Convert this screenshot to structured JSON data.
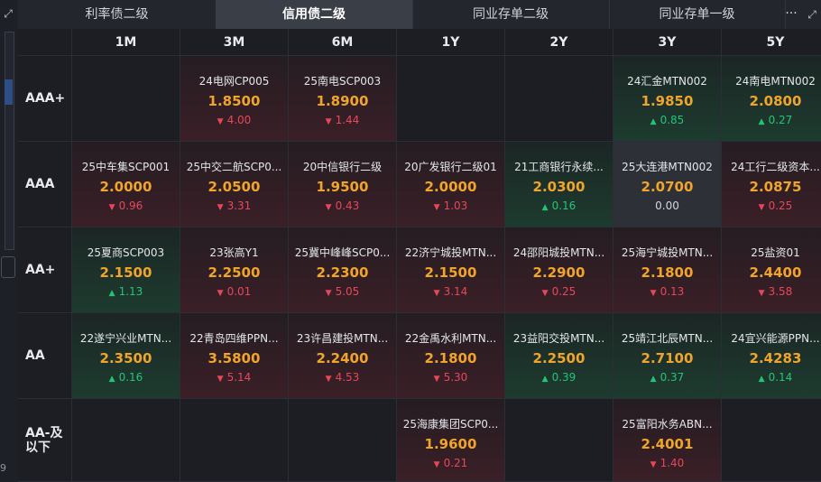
{
  "tabs": [
    {
      "label": "利率债二级",
      "active": false
    },
    {
      "label": "信用债二级",
      "active": true
    },
    {
      "label": "同业存单二级",
      "active": false
    },
    {
      "label": "同业存单一级",
      "active": false
    }
  ],
  "more_label": "···",
  "left_strip_number": "9",
  "columns": [
    "1M",
    "3M",
    "6M",
    "1Y",
    "2Y",
    "3Y",
    "5Y"
  ],
  "rows": [
    {
      "label": "AAA+",
      "cells": [
        null,
        {
          "name": "24电网CP005",
          "yield": "1.8500",
          "change": "4.00",
          "dir": "down",
          "tone": "red"
        },
        {
          "name": "25南电SCP003",
          "yield": "1.8900",
          "change": "1.44",
          "dir": "down",
          "tone": "red"
        },
        null,
        null,
        {
          "name": "24汇金MTN002",
          "yield": "1.9850",
          "change": "0.85",
          "dir": "up",
          "tone": "green"
        },
        {
          "name": "24南电MTN002",
          "yield": "2.0800",
          "change": "0.27",
          "dir": "up",
          "tone": "green"
        }
      ]
    },
    {
      "label": "AAA",
      "cells": [
        {
          "name": "25中车集SCP001",
          "yield": "2.0000",
          "change": "0.96",
          "dir": "down",
          "tone": "red"
        },
        {
          "name": "25中交二航SCP0...",
          "yield": "2.0500",
          "change": "3.31",
          "dir": "down",
          "tone": "red"
        },
        {
          "name": "20中信银行二级",
          "yield": "1.9500",
          "change": "0.43",
          "dir": "down",
          "tone": "red"
        },
        {
          "name": "20广发银行二级01",
          "yield": "2.0000",
          "change": "1.03",
          "dir": "down",
          "tone": "red"
        },
        {
          "name": "21工商银行永续...",
          "yield": "2.0300",
          "change": "0.16",
          "dir": "up",
          "tone": "green"
        },
        {
          "name": "25大连港MTN002",
          "yield": "2.0700",
          "change": "0.00",
          "dir": "flat",
          "tone": "gray"
        },
        {
          "name": "24工行二级资本...",
          "yield": "2.0875",
          "change": "0.25",
          "dir": "down",
          "tone": "red"
        }
      ]
    },
    {
      "label": "AA+",
      "cells": [
        {
          "name": "25夏商SCP003",
          "yield": "2.1500",
          "change": "1.13",
          "dir": "up",
          "tone": "green"
        },
        {
          "name": "23张高Y1",
          "yield": "2.2500",
          "change": "0.01",
          "dir": "down",
          "tone": "red"
        },
        {
          "name": "25冀中峰峰SCP0...",
          "yield": "2.2300",
          "change": "5.05",
          "dir": "down",
          "tone": "red"
        },
        {
          "name": "22济宁城投MTN...",
          "yield": "2.1500",
          "change": "3.14",
          "dir": "down",
          "tone": "red"
        },
        {
          "name": "24邵阳城投MTN...",
          "yield": "2.2900",
          "change": "0.25",
          "dir": "down",
          "tone": "red"
        },
        {
          "name": "25海宁城投MTN...",
          "yield": "2.1800",
          "change": "0.13",
          "dir": "down",
          "tone": "red"
        },
        {
          "name": "25盐资01",
          "yield": "2.4400",
          "change": "3.58",
          "dir": "down",
          "tone": "red"
        }
      ]
    },
    {
      "label": "AA",
      "cells": [
        {
          "name": "22遂宁兴业MTN...",
          "yield": "2.3500",
          "change": "0.16",
          "dir": "up",
          "tone": "green"
        },
        {
          "name": "22青岛四维PPN...",
          "yield": "3.5800",
          "change": "5.14",
          "dir": "down",
          "tone": "red"
        },
        {
          "name": "23许昌建投MTN...",
          "yield": "2.2400",
          "change": "4.53",
          "dir": "down",
          "tone": "red"
        },
        {
          "name": "22金禹水利MTN...",
          "yield": "2.1800",
          "change": "5.30",
          "dir": "down",
          "tone": "red"
        },
        {
          "name": "23益阳交投MTN...",
          "yield": "2.2500",
          "change": "0.39",
          "dir": "up",
          "tone": "green"
        },
        {
          "name": "25靖江北辰MTN...",
          "yield": "2.7100",
          "change": "0.37",
          "dir": "up",
          "tone": "green"
        },
        {
          "name": "24宜兴能源PPN...",
          "yield": "2.4283",
          "change": "0.14",
          "dir": "up",
          "tone": "green"
        }
      ]
    },
    {
      "label": "AA-及以下",
      "cells": [
        null,
        null,
        null,
        {
          "name": "25海康集团SCP0...",
          "yield": "1.9600",
          "change": "0.21",
          "dir": "down",
          "tone": "red"
        },
        null,
        {
          "name": "25富阳水务ABN...",
          "yield": "2.4001",
          "change": "1.40",
          "dir": "down",
          "tone": "red"
        },
        null
      ]
    }
  ]
}
